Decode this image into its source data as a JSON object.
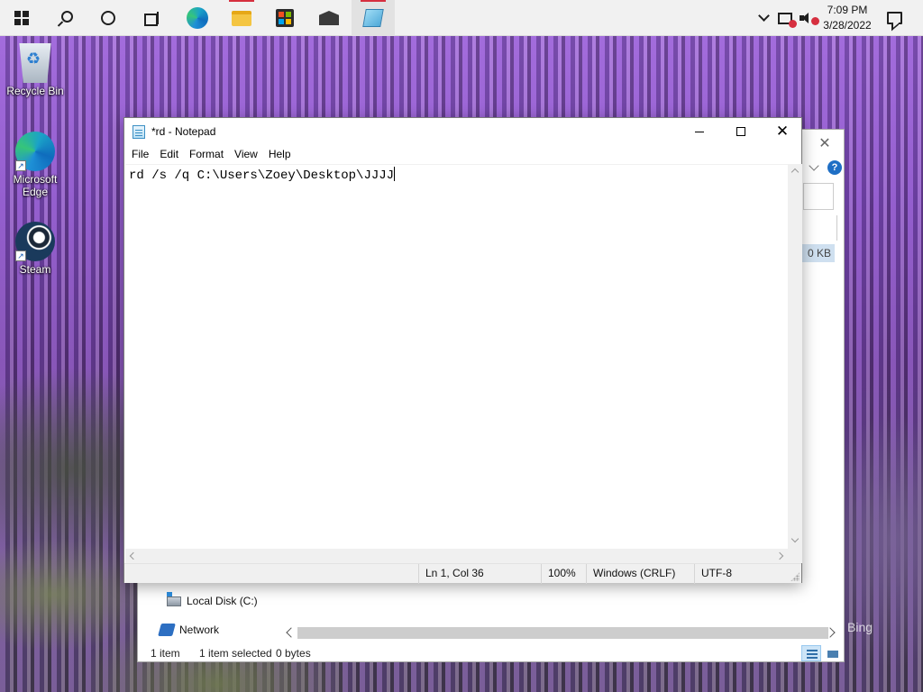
{
  "taskbar": {
    "apps": [
      {
        "name": "Microsoft Edge"
      },
      {
        "name": "File Explorer"
      },
      {
        "name": "Microsoft Store"
      },
      {
        "name": "Mail"
      },
      {
        "name": "Notepad"
      }
    ],
    "clock": {
      "time": "7:09 PM",
      "date": "3/28/2022"
    }
  },
  "desktop": {
    "icons": [
      {
        "label": "Recycle Bin"
      },
      {
        "label": "Microsoft Edge"
      },
      {
        "label": "Steam"
      }
    ],
    "watermark": "Bing"
  },
  "explorer": {
    "size_fragment": "0 KB",
    "nav": {
      "local_disk": "Local Disk (C:)",
      "network": "Network"
    },
    "status": {
      "items": "1 item",
      "selected": "1 item selected",
      "bytes": "0 bytes"
    }
  },
  "notepad": {
    "title": "*rd - Notepad",
    "menu": [
      "File",
      "Edit",
      "Format",
      "View",
      "Help"
    ],
    "content": "rd /s /q C:\\Users\\Zoey\\Desktop\\JJJJ",
    "status": {
      "position": "Ln 1, Col 36",
      "zoom": "100%",
      "line_ending": "Windows (CRLF)",
      "encoding": "UTF-8"
    }
  },
  "colors": {
    "accent_indicator": "#d62f3f",
    "help_blue": "#1f6fc5",
    "selection_blue": "#cce4f7"
  }
}
